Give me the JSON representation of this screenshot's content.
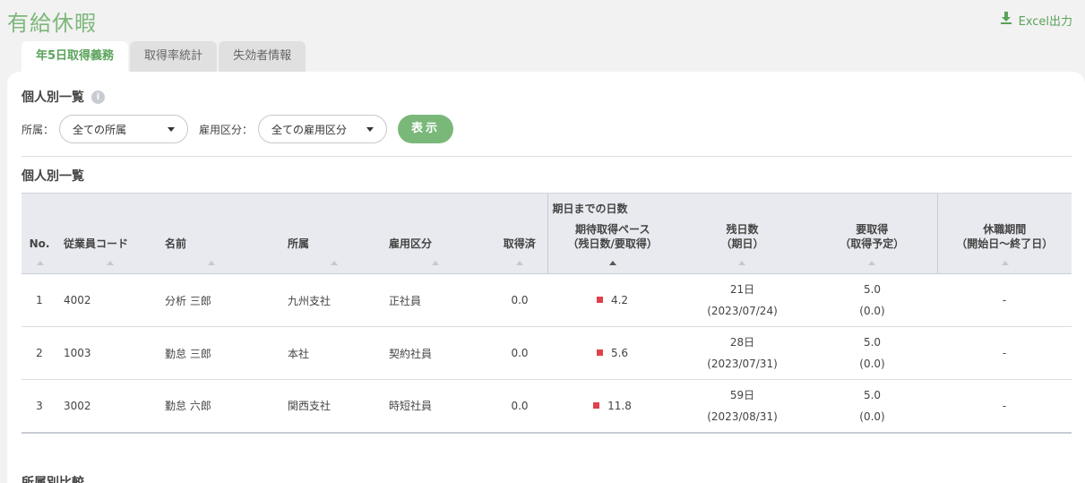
{
  "page": {
    "title": "有給休暇",
    "excel_label": "Excel出力"
  },
  "tabs": [
    {
      "label": "年5日取得義務",
      "active": true
    },
    {
      "label": "取得率統計",
      "active": false
    },
    {
      "label": "失効者情報",
      "active": false
    }
  ],
  "section": {
    "heading": "個人別一覧",
    "info_icon": "i",
    "list_heading": "個人別一覧",
    "next_heading": "所属別比較"
  },
  "filters": {
    "affiliation_label": "所属：",
    "affiliation_value": "全ての所属",
    "employment_label": "雇用区分：",
    "employment_value": "全ての雇用区分",
    "show_button": "表示"
  },
  "table": {
    "group_header": "期日までの日数",
    "columns": {
      "no": "No.",
      "code": "従業員コード",
      "name": "名前",
      "affiliation": "所属",
      "employment": "雇用区分",
      "taken": "取得済",
      "pace_line1": "期待取得ペース",
      "pace_line2": "（残日数/要取得）",
      "remaining_line1": "残日数",
      "remaining_line2": "（期日）",
      "required_line1": "要取得",
      "required_line2": "（取得予定）",
      "leave_line1": "休職期間",
      "leave_line2": "（開始日〜終了日）"
    },
    "rows": [
      {
        "no": "1",
        "code": "4002",
        "name": "分析 三郎",
        "affiliation": "九州支社",
        "employment": "正社員",
        "taken": "0.0",
        "pace": "4.2",
        "remaining_days": "21日",
        "due_date": "(2023/07/24)",
        "required": "5.0",
        "planned": "(0.0)",
        "leave": "-"
      },
      {
        "no": "2",
        "code": "1003",
        "name": "勤怠 三郎",
        "affiliation": "本社",
        "employment": "契約社員",
        "taken": "0.0",
        "pace": "5.6",
        "remaining_days": "28日",
        "due_date": "(2023/07/31)",
        "required": "5.0",
        "planned": "(0.0)",
        "leave": "-"
      },
      {
        "no": "3",
        "code": "3002",
        "name": "勤怠 六郎",
        "affiliation": "関西支社",
        "employment": "時短社員",
        "taken": "0.0",
        "pace": "11.8",
        "remaining_days": "59日",
        "due_date": "(2023/08/31)",
        "required": "5.0",
        "planned": "(0.0)",
        "leave": "-"
      }
    ]
  },
  "colors": {
    "accent_green": "#7cb87a",
    "button_green": "#7ab87a",
    "alert_red": "#e0404a",
    "header_bg": "#e8eaef"
  }
}
